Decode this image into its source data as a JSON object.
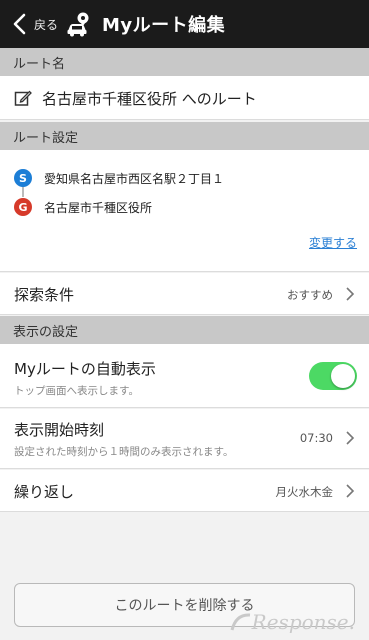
{
  "header": {
    "back_label": "戻る",
    "title": "Myルート編集"
  },
  "route_name_section": {
    "heading": "ルート名",
    "value": "名古屋市千種区役所 へのルート"
  },
  "route_settings_section": {
    "heading": "ルート設定",
    "start": {
      "marker": "S",
      "address": "愛知県名古屋市西区名駅２丁目１",
      "color": "#1c7ed6"
    },
    "goal": {
      "marker": "G",
      "address": "名古屋市千種区役所",
      "color": "#d63a2a"
    },
    "change_link": "変更する"
  },
  "search_conditions": {
    "label": "探索条件",
    "value": "おすすめ"
  },
  "display_settings_section": {
    "heading": "表示の設定",
    "auto_display": {
      "label": "Myルートの自動表示",
      "sub": "トップ画面へ表示します。",
      "enabled": true,
      "color": "#4cd964"
    },
    "start_time": {
      "label": "表示開始時刻",
      "sub": "設定された時刻から１時間のみ表示されます。",
      "value": "07:30"
    },
    "repeat": {
      "label": "繰り返し",
      "value": "月火水木金"
    }
  },
  "delete_button": "このルートを削除する",
  "watermark": "Response."
}
